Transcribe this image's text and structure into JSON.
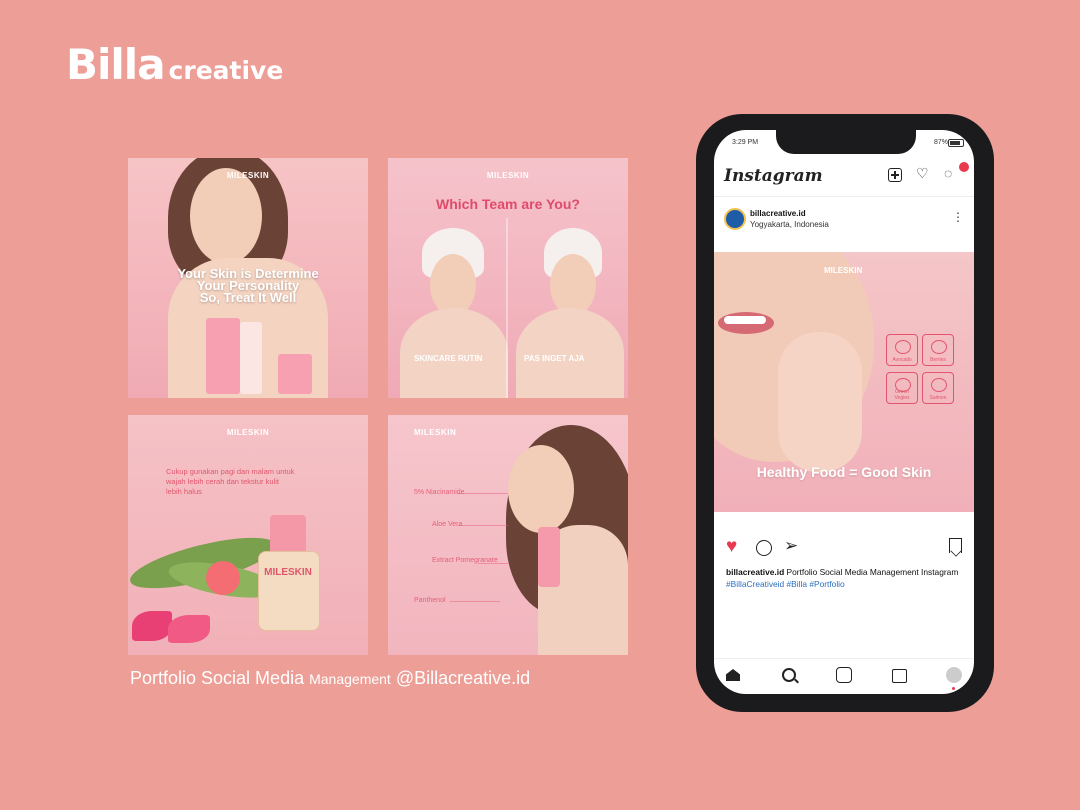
{
  "brand": {
    "name": "Billa",
    "suffix": "creative"
  },
  "tiles": {
    "t1": {
      "brand": "MILESKIN",
      "message": "Your Skin is Determine\nYour Personality\nSo, Treat It Well"
    },
    "t2": {
      "brand": "MILESKIN",
      "question": "Which Team are You?",
      "left_label": "SKINCARE RUTIN",
      "right_label": "PAS INGET AJA"
    },
    "t3": {
      "brand": "MILESKIN",
      "text": "Cukup gunakan pagi dan malam untuk wajah lebih cerah dan tekstur kulit lebih halus",
      "bottle_label": "MILESKIN"
    },
    "t4": {
      "brand": "MILESKIN",
      "ingredients": [
        "5% Niacinamide",
        "Aloe Vera",
        "Extract Pomegranate",
        "Panthenol"
      ]
    }
  },
  "caption": {
    "part1": "Portfolio Social Media",
    "part2": "Management",
    "part3": "@Billacreative.id"
  },
  "phone": {
    "status_time": "3:29 PM",
    "status_battery": "87%",
    "app_logo": "Instagram",
    "account": "billacreative.id",
    "location": "Yogyakarta, Indonesia",
    "post_brand": "MILESKIN",
    "post_slogan": "Healthy Food = Good Skin",
    "foods": [
      "Avocado",
      "Berries",
      "Green Vegies",
      "Salmon"
    ],
    "caption_user": "billacreative.id",
    "caption_text": "Portfolio Social Media Management Instagram",
    "hashtags": "#BillaCreativeid #Billa #Portfolio"
  },
  "colors": {
    "background": "#ec9e97",
    "accent": "#e04a6b",
    "like": "#e8394f",
    "hashtag": "#2b6fc2"
  }
}
